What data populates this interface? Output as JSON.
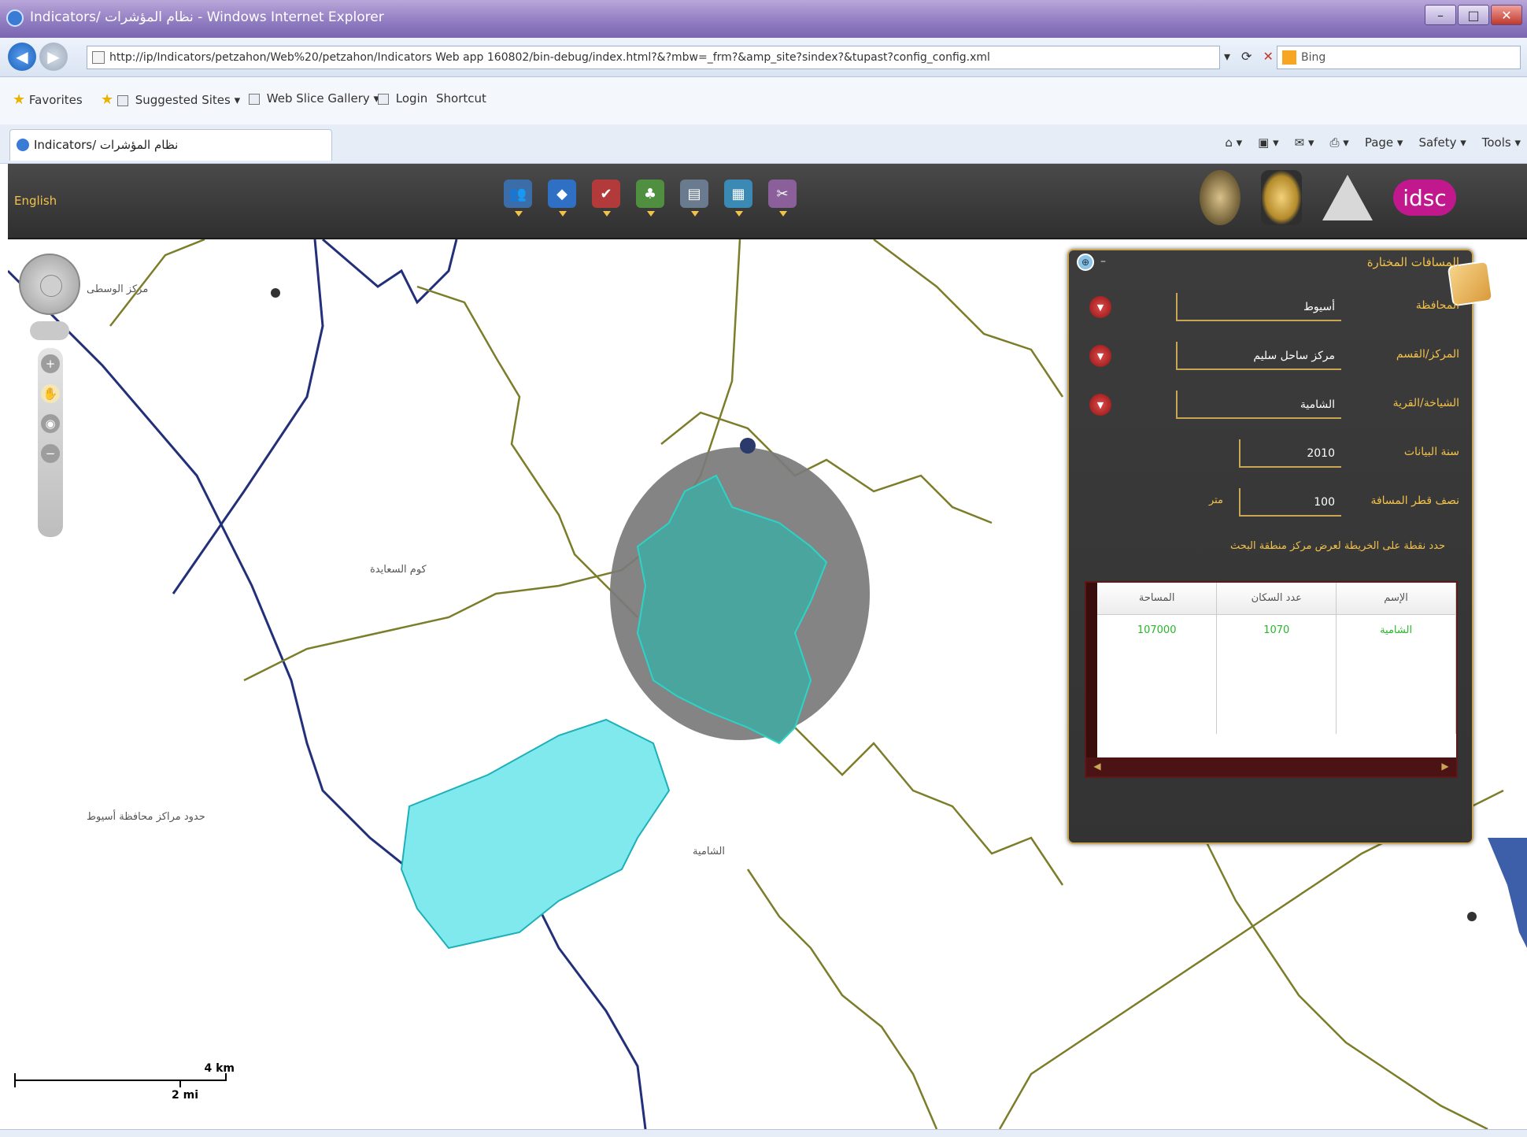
{
  "window": {
    "title": "Indicators/ نظام المؤشرات - Windows Internet Explorer",
    "minimize": "–",
    "maximize": "□",
    "close": "✕"
  },
  "address": {
    "url": "http://ip/Indicators/petzahon/Web%20/petzahon/Indicators Web app 160802/bin-debug/index.html?&?mbw=_frm?&amp_site?sindex?&tupast?config_config.xml",
    "search_placeholder": "Bing"
  },
  "favorites": {
    "favorites_label": "Favorites",
    "suggested_label": "Suggested Sites ▾",
    "gallery_label": "Web Slice Gallery ▾",
    "login_label": "Login",
    "shortcut_label": "Shortcut"
  },
  "tab": {
    "label": "Indicators/ نظام المؤشرات"
  },
  "commandbar": {
    "page_label": "Page ▾",
    "safety_label": "Safety ▾",
    "tools_label": "Tools ▾"
  },
  "app": {
    "lang_label": "English",
    "logo_text": "idsc"
  },
  "map": {
    "scale_km": "4 km",
    "scale_mi": "2 mi"
  },
  "panel": {
    "title": "المسافات المختارة",
    "rows": [
      {
        "label": "المحافظة",
        "value": "أسيوط"
      },
      {
        "label": "المركز/القسم",
        "value": "مركز ساحل سليم"
      },
      {
        "label": "الشياخة/القرية",
        "value": "الشامية"
      },
      {
        "label": "سنة البيانات",
        "value": "2010"
      },
      {
        "label": "نصف قطر المسافة",
        "value": "100",
        "unit": "متر"
      }
    ],
    "note": "حدد نقطة على الخريطة لعرض مركز منطقة البحث",
    "table": {
      "headers": [
        "الإسم",
        "عدد السكان",
        "المساحة"
      ],
      "rows": [
        [
          "الشامية",
          "1070",
          "107000"
        ]
      ]
    }
  }
}
